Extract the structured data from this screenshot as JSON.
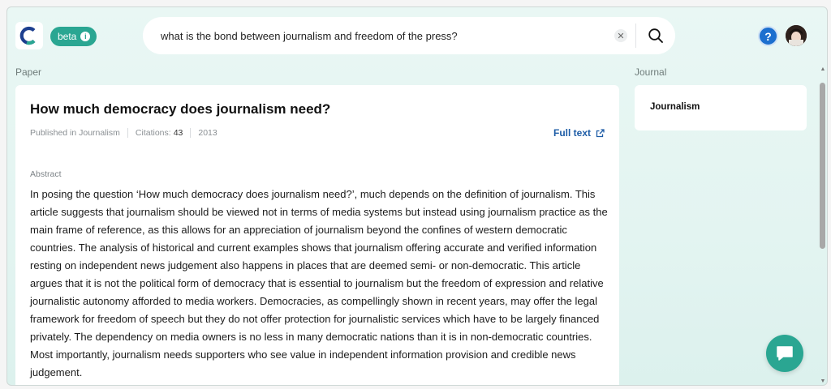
{
  "header": {
    "beta_label": "beta",
    "search_value": "what is the bond between journalism and freedom of the press?",
    "help_label": "?"
  },
  "paper": {
    "section_label": "Paper",
    "title": "How much democracy does journalism need?",
    "published_in": "Published in Journalism",
    "citations_label": "Citations:",
    "citations_value": "43",
    "year": "2013",
    "full_text_label": "Full text",
    "abstract_label": "Abstract",
    "abstract": "In posing the question ‘How much democracy does journalism need?’, much depends on the definition of journalism. This article suggests that journalism should be viewed not in terms of media systems but instead using journalism practice as the main frame of reference, as this allows for an appreciation of journalism beyond the confines of western democratic countries. The analysis of historical and current examples shows that journalism offering accurate and verified information resting on independent news judgement also happens in places that are deemed semi- or non-democratic. This article argues that it is not the political form of democracy that is essential to journalism but the freedom of expression and relative journalistic autonomy afforded to media workers. Democracies, as compellingly shown in recent years, may offer the legal framework for freedom of speech but they do not offer protection for journalistic services which have to be largely financed privately. The dependency on media owners is no less in many democratic nations than it is in non-democratic countries. Most importantly, journalism needs supporters who see value in independent information provision and credible news judgement."
  },
  "journal": {
    "section_label": "Journal",
    "name": "Journalism"
  },
  "colors": {
    "accent": "#2aa692",
    "link": "#1d5ca6",
    "help": "#1c6fcf"
  },
  "icons": [
    "app-logo-icon",
    "info-icon",
    "clear-icon",
    "search-icon",
    "help-icon",
    "external-link-icon",
    "chat-icon"
  ]
}
